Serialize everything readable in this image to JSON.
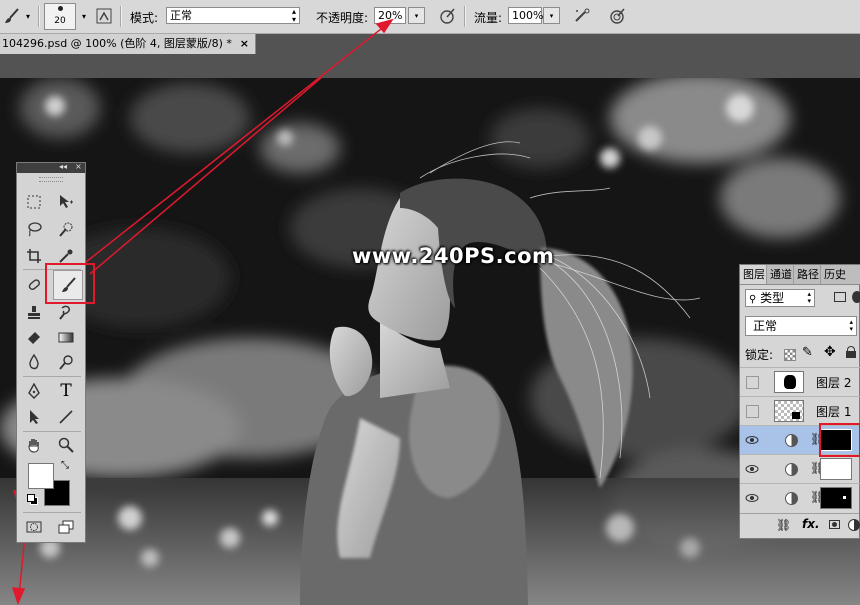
{
  "options_bar": {
    "brush_size": "20",
    "mode_label": "模式:",
    "mode_value": "正常",
    "opacity_label": "不透明度:",
    "opacity_value": "20%",
    "flow_label": "流量:",
    "flow_value": "100%"
  },
  "document_tab": {
    "title": "104296.psd @ 100% (色阶 4, 图层蒙版/8) *",
    "close": "×"
  },
  "watermark": "www.240PS.com",
  "toolbox": {
    "collapse_glyph": "◂◂",
    "close_glyph": "×",
    "foreground_color": "#ffffff",
    "background_color": "#000000"
  },
  "layers_panel": {
    "tabs": [
      "图层",
      "通道",
      "路径",
      "历史"
    ],
    "filter_label": "类型",
    "blend_mode": "正常",
    "lock_label": "锁定:",
    "layers": [
      {
        "name": "图层 2",
        "visible": false
      },
      {
        "name": "图层 1",
        "visible": false
      },
      {
        "name": "",
        "visible": true,
        "type": "adjustment",
        "selected": true
      },
      {
        "name": "",
        "visible": true,
        "type": "adjustment"
      },
      {
        "name": "",
        "visible": true,
        "type": "adjustment"
      }
    ],
    "footer_fx": "fx."
  },
  "colors": {
    "annotation_red": "#e0192d",
    "panel_bg": "#d6d6d6",
    "selected_row": "#a9c3e8"
  }
}
